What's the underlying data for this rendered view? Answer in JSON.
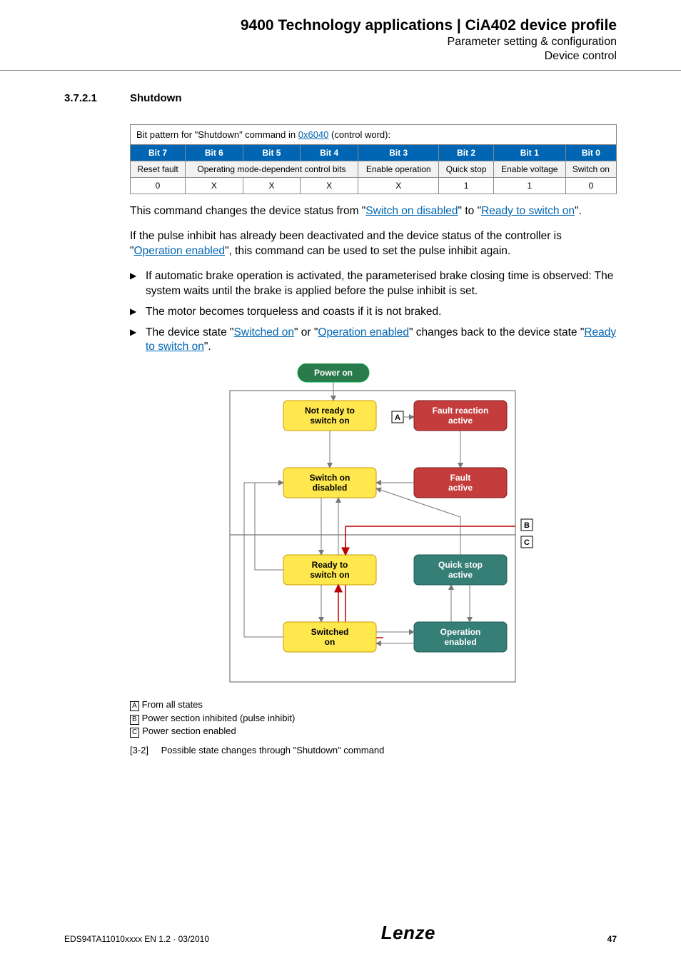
{
  "header": {
    "title": "9400 Technology applications | CiA402 device profile",
    "sub1": "Parameter setting & configuration",
    "sub2": "Device control"
  },
  "section": {
    "num": "3.7.2.1",
    "title": "Shutdown"
  },
  "table": {
    "caption_pre": "Bit pattern for \"Shutdown\" command in ",
    "caption_link": "0x6040",
    "caption_post": " (control word):",
    "headers": [
      "Bit 7",
      "Bit 6",
      "Bit 5",
      "Bit 4",
      "Bit 3",
      "Bit 2",
      "Bit 1",
      "Bit 0"
    ],
    "labels": {
      "b7": "Reset fault",
      "b654": "Operating mode-dependent control bits",
      "b3": "Enable operation",
      "b2": "Quick stop",
      "b1": "Enable voltage",
      "b0": "Switch on"
    },
    "values": [
      "0",
      "X",
      "X",
      "X",
      "X",
      "1",
      "1",
      "0"
    ]
  },
  "para1": {
    "pre": "This command changes the device status from \"",
    "l1": "Switch on disabled",
    "mid": "\" to \"",
    "l2": "Ready to switch on",
    "post": "\"."
  },
  "para2": {
    "pre": "If the pulse inhibit has already been deactivated and the device status of the controller is \"",
    "l1": "Operation enabled",
    "post": "\", this command can be used to set the pulse inhibit again."
  },
  "bullets": {
    "b1": "If automatic brake operation is activated, the parameterised brake closing time is observed: The system waits until the brake is applied before the pulse inhibit is set.",
    "b2": "The motor becomes torqueless and coasts if it is not braked.",
    "b3_pre": "The device state \"",
    "b3_l1": "Switched on",
    "b3_mid1": "\" or \"",
    "b3_l2": "Operation enabled",
    "b3_mid2": "\" changes back to the device state \"",
    "b3_l3": "Ready to switch on",
    "b3_post": "\"."
  },
  "diagram": {
    "nodes": {
      "power_on": "Power on",
      "not_ready": "Not ready to switch on",
      "fault_reaction": "Fault reaction active",
      "switch_on_disabled": "Switch on disabled",
      "fault_active": "Fault active",
      "ready": "Ready to switch on",
      "quick_stop": "Quick stop active",
      "switched_on": "Switched on",
      "operation_enabled": "Operation enabled"
    },
    "tags": {
      "A": "A",
      "B": "B",
      "C": "C"
    }
  },
  "legend": {
    "A": "From all states",
    "B": "Power section inhibited (pulse inhibit)",
    "C": "Power section enabled"
  },
  "figure": {
    "num": "[3-2]",
    "caption": "Possible state changes through \"Shutdown\" command"
  },
  "footer": {
    "doc": "EDS94TA11010xxxx EN 1.2 · 03/2010",
    "logo": "Lenze",
    "page": "47"
  }
}
